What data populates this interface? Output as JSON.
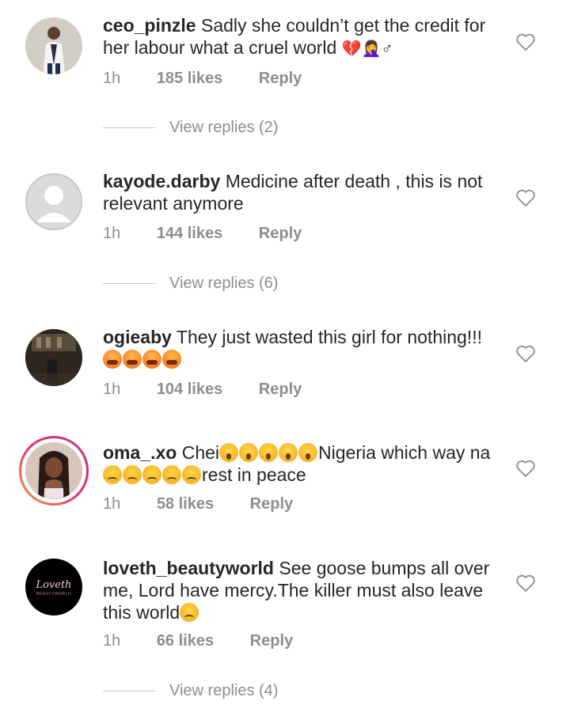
{
  "comments": [
    {
      "username": "ceo_pinzle",
      "text": "Sadly she couldn’t get the credit for her labour what a cruel world",
      "trailing_glyphs": "💔🤦‍♀️♂",
      "time": "1h",
      "likes": "185 likes",
      "reply": "Reply",
      "view_replies": "View replies (2)"
    },
    {
      "username": "kayode.darby",
      "text": "Medicine after death , this is not relevant anymore",
      "time": "1h",
      "likes": "144 likes",
      "reply": "Reply",
      "view_replies": "View replies (6)"
    },
    {
      "username": "ogieaby",
      "text": "They just wasted this girl for nothing!!!",
      "emoji_line": "😭😭😭😭",
      "time": "1h",
      "likes": "104 likes",
      "reply": "Reply"
    },
    {
      "username": "oma_.xo",
      "text_a": "Chei",
      "text_b": "Nigeria which way na",
      "text_c": "rest in peace",
      "time": "1h",
      "likes": "58 likes",
      "reply": "Reply"
    },
    {
      "username": "loveth_beautyworld",
      "text": "See goose bumps all over me, Lord have mercy.The killer must also leave this world",
      "trailing_emoji": "☹",
      "time": "1h",
      "likes": "66 likes",
      "reply": "Reply",
      "view_replies": "View replies (4)",
      "avatar_logo": "Loveth",
      "avatar_subtitle": "BEAUTYWORLD"
    }
  ]
}
